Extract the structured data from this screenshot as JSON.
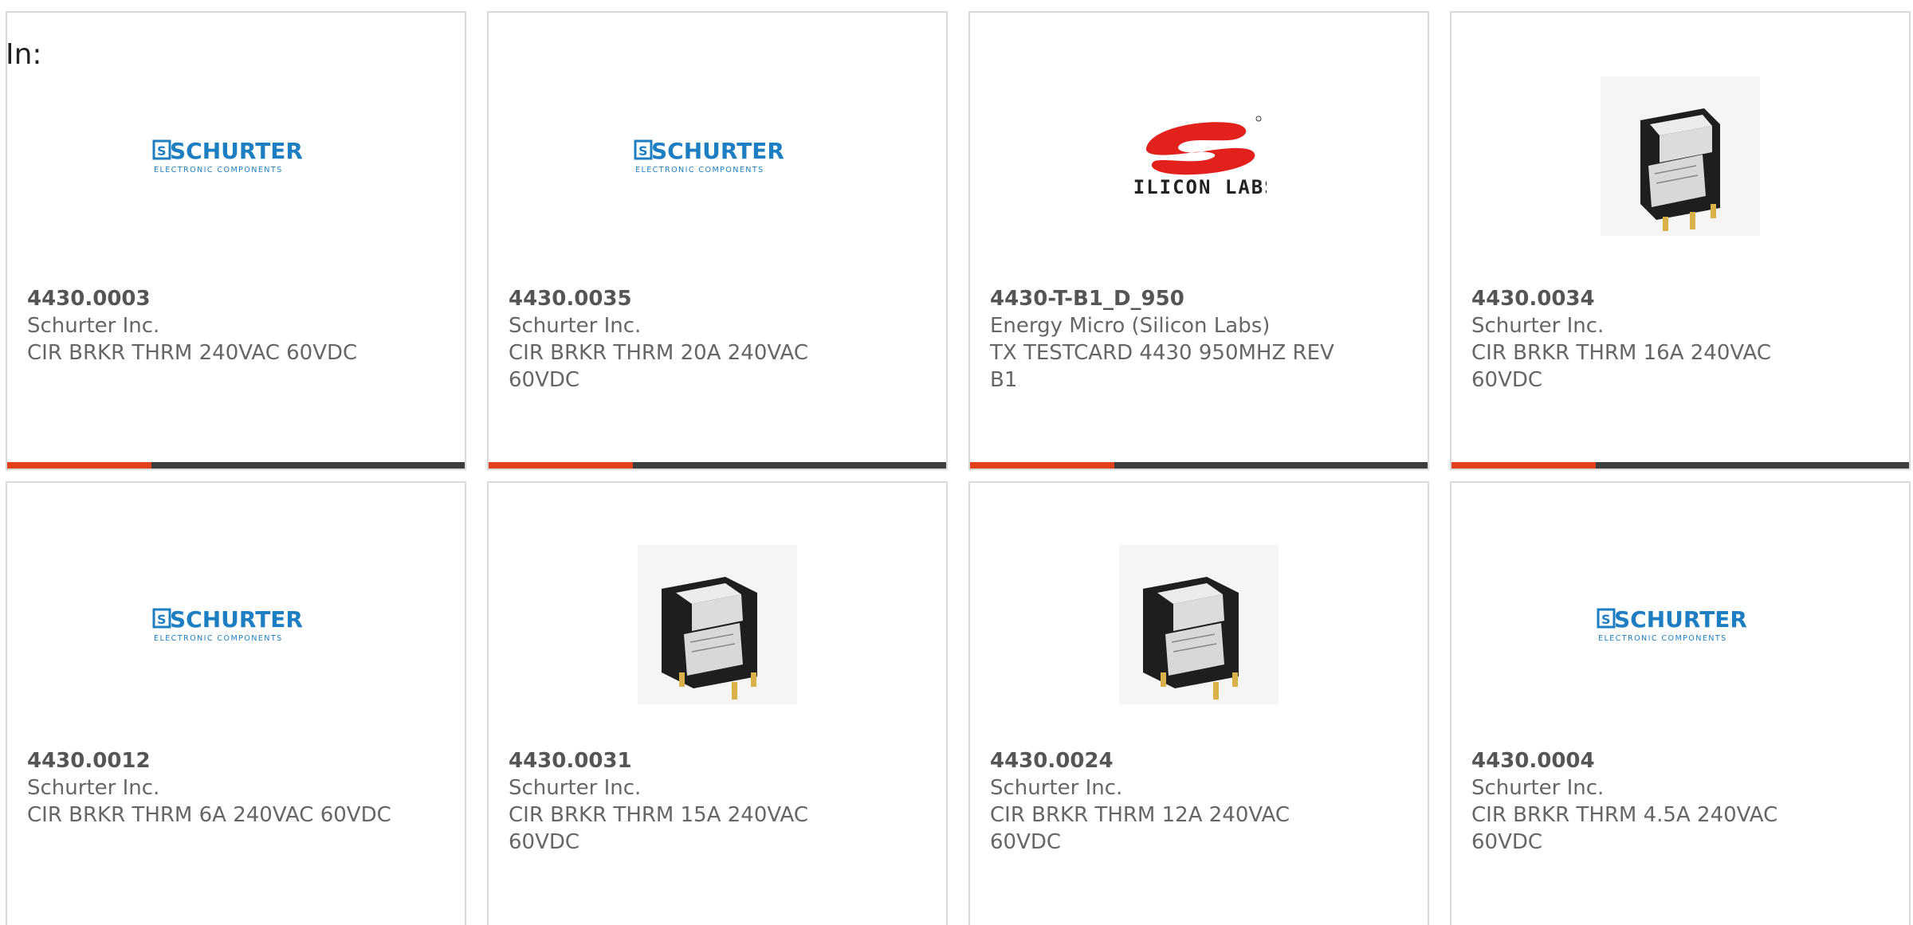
{
  "filter": {
    "in_label": "In:"
  },
  "colors": {
    "accent": "#e2401c",
    "bar": "#3d3d3d",
    "schurter_blue": "#1d7fc2",
    "silicon_red": "#e2211c",
    "text_gray": "#666666"
  },
  "products": [
    {
      "part": "4430.0003",
      "mfr": "Schurter Inc.",
      "desc": "CIR BRKR THRM 240VAC 60VDC",
      "image": "schurter-logo"
    },
    {
      "part": "4430.0035",
      "mfr": "Schurter Inc.",
      "desc": "CIR BRKR THRM 20A 240VAC 60VDC",
      "image": "schurter-logo"
    },
    {
      "part": "4430-T-B1_D_950",
      "mfr": "Energy Micro (Silicon Labs)",
      "desc": "TX TESTCARD 4430 950MHZ REV B1",
      "image": "silicon-labs-logo"
    },
    {
      "part": "4430.0034",
      "mfr": "Schurter Inc.",
      "desc": "CIR BRKR THRM 16A 240VAC 60VDC",
      "image": "rocker-switch-photo"
    },
    {
      "part": "4430.0012",
      "mfr": "Schurter Inc.",
      "desc": "CIR BRKR THRM 6A 240VAC 60VDC",
      "image": "schurter-logo"
    },
    {
      "part": "4430.0031",
      "mfr": "Schurter Inc.",
      "desc": "CIR BRKR THRM 15A 240VAC 60VDC",
      "image": "rocker-switch-photo"
    },
    {
      "part": "4430.0024",
      "mfr": "Schurter Inc.",
      "desc": "CIR BRKR THRM 12A 240VAC 60VDC",
      "image": "rocker-switch-photo"
    },
    {
      "part": "4430.0004",
      "mfr": "Schurter Inc.",
      "desc": "CIR BRKR THRM 4.5A 240VAC 60VDC",
      "image": "schurter-logo"
    }
  ],
  "logos": {
    "schurter": {
      "name": "SCHURTER",
      "tagline": "ELECTRONIC COMPONENTS"
    },
    "silicon_labs": {
      "name": "SILICON LABS"
    }
  }
}
